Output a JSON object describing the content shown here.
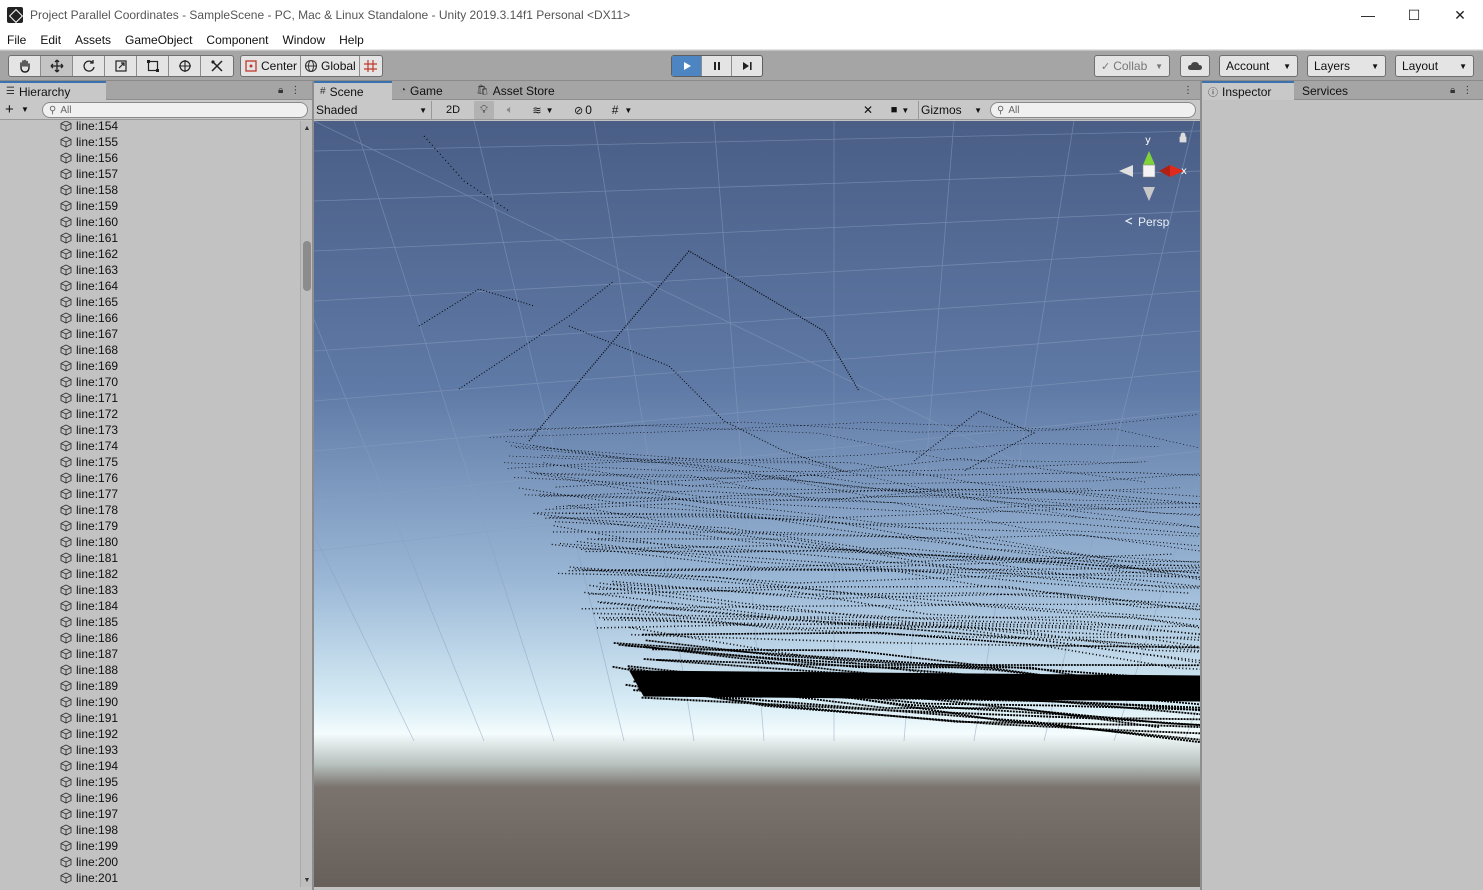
{
  "window": {
    "title": "Project Parallel Coordinates - SampleScene - PC, Mac & Linux Standalone - Unity 2019.3.14f1 Personal <DX11>",
    "minimize": "—",
    "maximize": "☐",
    "close": "✕"
  },
  "menu": [
    "File",
    "Edit",
    "Assets",
    "GameObject",
    "Component",
    "Window",
    "Help"
  ],
  "toolbar": {
    "pivot_label": "Center",
    "space_label": "Global",
    "collab_label": "Collab",
    "account_label": "Account",
    "layers_label": "Layers",
    "layout_label": "Layout"
  },
  "hierarchy": {
    "tab_label": "Hierarchy",
    "search_placeholder": "All",
    "items": [
      "line:154",
      "line:155",
      "line:156",
      "line:157",
      "line:158",
      "line:159",
      "line:160",
      "line:161",
      "line:162",
      "line:163",
      "line:164",
      "line:165",
      "line:166",
      "line:167",
      "line:168",
      "line:169",
      "line:170",
      "line:171",
      "line:172",
      "line:173",
      "line:174",
      "line:175",
      "line:176",
      "line:177",
      "line:178",
      "line:179",
      "line:180",
      "line:181",
      "line:182",
      "line:183",
      "line:184",
      "line:185",
      "line:186",
      "line:187",
      "line:188",
      "line:189",
      "line:190",
      "line:191",
      "line:192",
      "line:193",
      "line:194",
      "line:195",
      "line:196",
      "line:197",
      "line:198",
      "line:199",
      "line:200",
      "line:201"
    ]
  },
  "scene": {
    "tabs": [
      "Scene",
      "Game",
      "Asset Store"
    ],
    "shading_mode": "Shaded",
    "mode_2d": "2D",
    "hidden_count": "0",
    "gizmos_label": "Gizmos",
    "search_placeholder": "All",
    "gizmo_x": "x",
    "gizmo_y": "y",
    "projection_label": "Persp"
  },
  "inspector": {
    "tabs": [
      "Inspector",
      "Services"
    ]
  },
  "colors": {
    "accent": "#4d85c2",
    "sky_top": "#4a5e86",
    "horizon": "#f2fbfd",
    "ground": "#665f5a"
  }
}
